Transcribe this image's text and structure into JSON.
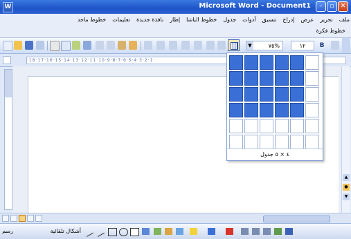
{
  "window": {
    "title": "Microsoft Word - Document1",
    "app_icon_glyph": "W"
  },
  "menubar": {
    "items": [
      "ملف",
      "تحرير",
      "عرض",
      "إدراج",
      "تنسيق",
      "أدوات",
      "جدول",
      "خطوط الباشا",
      "إطار",
      "نافذة جديدة",
      "تعليمات",
      "خطوط ماجد"
    ],
    "second_row": "خطوط فكرة"
  },
  "toolbar": {
    "zoom_value": "%٧٥",
    "font_size": "١٢",
    "bold_label": "B"
  },
  "ruler": {
    "text": "·18·17·16·15·14·13·12·11·10·9·8·7·6·5·4·3·2·1·"
  },
  "table_picker": {
    "rows": 6,
    "cols": 6,
    "selected_rows": 4,
    "selected_cols": 5,
    "size_label": "٤ × ٥ جدول",
    "highlight_color": "#3a6fd6"
  },
  "drawbar": {
    "draw_label": "رسم",
    "autoshapes_label": "أشكال تلقائية"
  }
}
